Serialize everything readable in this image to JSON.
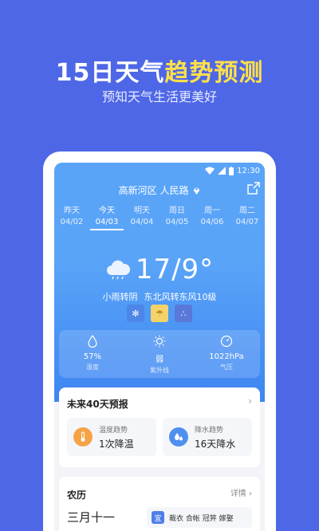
{
  "promo": {
    "title_prefix": "15日天气",
    "title_highlight": "趋势预测",
    "subtitle": "预知天气生活更美好"
  },
  "status_bar": {
    "time": "12:30"
  },
  "location": {
    "name": "高新河区 人民路"
  },
  "days": [
    {
      "label": "昨天",
      "date": "04/02"
    },
    {
      "label": "今天",
      "date": "04/03"
    },
    {
      "label": "明天",
      "date": "04/04"
    },
    {
      "label": "周日",
      "date": "04/05"
    },
    {
      "label": "周一",
      "date": "04/06"
    },
    {
      "label": "周二",
      "date": "04/07"
    }
  ],
  "current": {
    "temperature": "17/9°",
    "condition": "小雨转阴",
    "wind": "东北风转东风10级"
  },
  "stats": [
    {
      "value": "57%",
      "label": "湿度",
      "icon": "droplet-icon"
    },
    {
      "value": "弱",
      "label": "紫外线",
      "icon": "sun-icon"
    },
    {
      "value": "1022hPa",
      "label": "气压",
      "icon": "gauge-icon"
    }
  ],
  "forecast": {
    "title": "未来40天预报",
    "temp_trend_label": "温度趋势",
    "temp_trend_value": "1次降温",
    "rain_trend_label": "降水趋势",
    "rain_trend_value": "16天降水"
  },
  "lunar": {
    "title": "农历",
    "more": "详情",
    "date": "三月十一",
    "yi_label": "宜",
    "yi_items": "裁衣 合帐 冠笄 嫁娶"
  },
  "colors": {
    "background": "#4e67e6",
    "highlight": "#ffe04a",
    "sky": "#5aa4f8"
  }
}
